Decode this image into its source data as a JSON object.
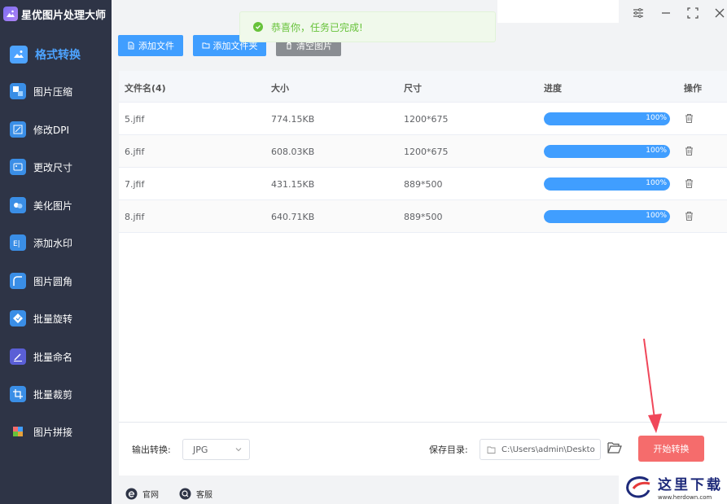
{
  "app": {
    "title": "星优图片处理大师"
  },
  "sidebar": {
    "items": [
      {
        "label": "格式转换",
        "icon": "image-convert-icon",
        "color": "#4da3ff",
        "active": true
      },
      {
        "label": "图片压缩",
        "icon": "compress-icon",
        "color": "#3a8ee6"
      },
      {
        "label": "修改DPI",
        "icon": "dpi-icon",
        "color": "#3a8ee6"
      },
      {
        "label": "更改尺寸",
        "icon": "resize-icon",
        "color": "#3a8ee6"
      },
      {
        "label": "美化图片",
        "icon": "beautify-icon",
        "color": "#3a8ee6"
      },
      {
        "label": "添加水印",
        "icon": "watermark-icon",
        "color": "#3a8ee6"
      },
      {
        "label": "图片圆角",
        "icon": "round-corner-icon",
        "color": "#3a8ee6"
      },
      {
        "label": "批量旋转",
        "icon": "rotate-icon",
        "color": "#3a8ee6"
      },
      {
        "label": "批量命名",
        "icon": "rename-icon",
        "color": "#5a5fd6"
      },
      {
        "label": "批量裁剪",
        "icon": "crop-icon",
        "color": "#3a8ee6"
      },
      {
        "label": "图片拼接",
        "icon": "puzzle-icon",
        "color": "#e6a23c"
      }
    ]
  },
  "toolbar": {
    "add_file": "添加文件",
    "add_folder": "添加文件夹",
    "clear": "清空图片"
  },
  "toast": {
    "message": "恭喜你，任务已完成!"
  },
  "table": {
    "headers": {
      "name": "文件名(4)",
      "size": "大小",
      "dimensions": "尺寸",
      "progress": "进度",
      "actions": "操作"
    },
    "rows": [
      {
        "name": "5.jfif",
        "size": "774.15KB",
        "dimensions": "1200*675",
        "progress": 1.0,
        "progress_label": "100%"
      },
      {
        "name": "6.jfif",
        "size": "608.03KB",
        "dimensions": "1200*675",
        "progress": 1.0,
        "progress_label": "100%"
      },
      {
        "name": "7.jfif",
        "size": "431.15KB",
        "dimensions": "889*500",
        "progress": 1.0,
        "progress_label": "100%"
      },
      {
        "name": "8.jfif",
        "size": "640.71KB",
        "dimensions": "889*500",
        "progress": 1.0,
        "progress_label": "100%"
      }
    ]
  },
  "bottom": {
    "output_label": "输出转换:",
    "output_format": "JPG",
    "save_label": "保存目录:",
    "save_path": "C:\\Users\\admin\\Deskto",
    "start_button": "开始转换"
  },
  "footer": {
    "website": "官网",
    "support": "客服"
  },
  "watermark": {
    "cn": "这里下载",
    "en": "www.herdown.com"
  },
  "colors": {
    "sidebar_bg": "#2e3446",
    "accent": "#409eff",
    "start": "#f56c6c",
    "success": "#67c23a"
  }
}
